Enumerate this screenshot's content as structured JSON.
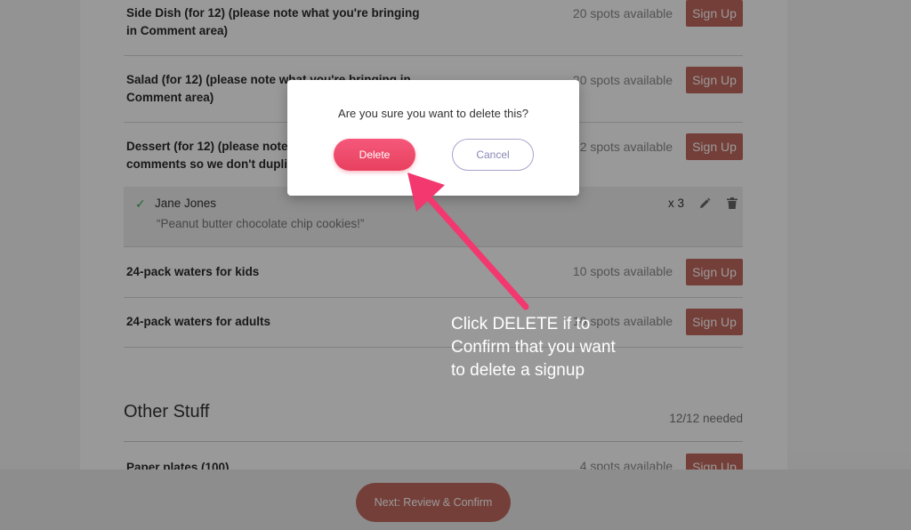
{
  "slots": [
    {
      "title": "Side Dish (for 12) (please note what you're bringing in Comment area)",
      "spots": "20 spots available",
      "button": "Sign Up"
    },
    {
      "title": "Salad (for 12) (please note what you're bringing in Comment area)",
      "spots": "20 spots available",
      "button": "Sign Up"
    },
    {
      "title": "Dessert (for 12) (please note what you're bringing in comments so we don't duplicate)",
      "spots": "22 spots available",
      "button": "Sign Up"
    },
    {
      "title": "24-pack waters for kids",
      "spots": "10 spots available",
      "button": "Sign Up"
    },
    {
      "title": "24-pack waters for adults",
      "spots": "10 spots available",
      "button": "Sign Up"
    }
  ],
  "signup_entry": {
    "name": "Jane Jones",
    "comment": "“Peanut butter chocolate chip cookies!”",
    "quantity": "x 3",
    "check_icon": "check-icon",
    "edit_icon": "pencil-icon",
    "delete_icon": "trash-icon"
  },
  "section": {
    "title": "Other Stuff",
    "needed": "12/12 needed",
    "first_item": {
      "title": "Paper plates (100)",
      "spots": "4 spots available",
      "button": "Sign Up"
    }
  },
  "footer": {
    "next_label": "Next: Review & Confirm"
  },
  "modal": {
    "question": "Are you sure you want to delete this?",
    "delete_label": "Delete",
    "cancel_label": "Cancel"
  },
  "annotation": {
    "line1": "Click DELETE if to",
    "line2": "Confirm that you want",
    "line3": "to delete a signup",
    "arrow_color": "#f2386f"
  },
  "colors": {
    "signup_button": "#c46a60",
    "delete_gradient_top": "#f5587a",
    "delete_gradient_bottom": "#e8405f",
    "cancel_border": "#a8a4cc",
    "check": "#3aaa55"
  }
}
